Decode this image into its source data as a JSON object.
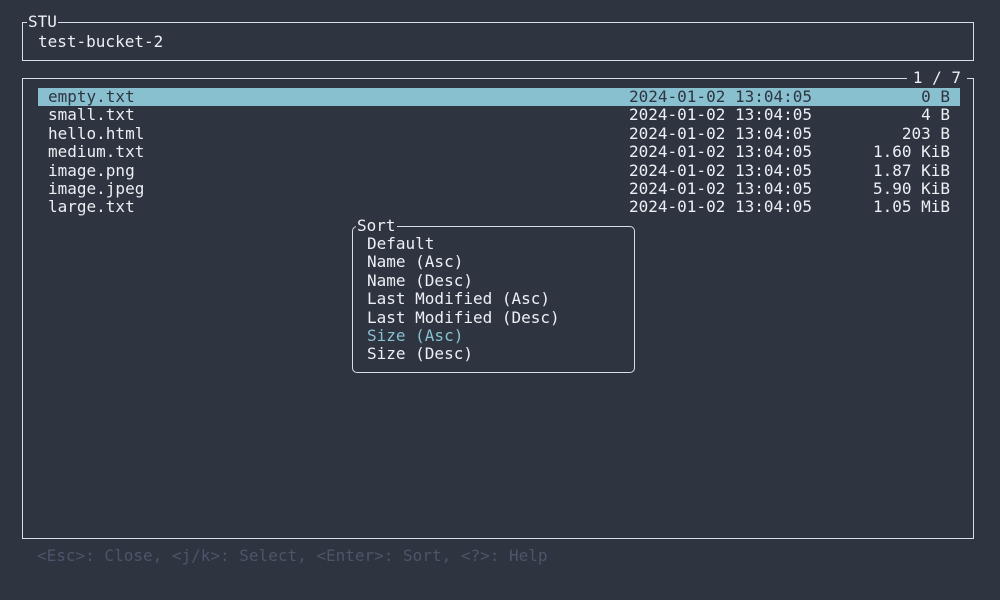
{
  "app": {
    "title": "STU",
    "bucket": "test-bucket-2"
  },
  "list": {
    "page_indicator": "1 / 7",
    "selected_index": 0,
    "items": [
      {
        "name": "empty.txt",
        "modified": "2024-01-02 13:04:05",
        "size": "0 B"
      },
      {
        "name": "small.txt",
        "modified": "2024-01-02 13:04:05",
        "size": "4 B"
      },
      {
        "name": "hello.html",
        "modified": "2024-01-02 13:04:05",
        "size": "203 B"
      },
      {
        "name": "medium.txt",
        "modified": "2024-01-02 13:04:05",
        "size": "1.60 KiB"
      },
      {
        "name": "image.png",
        "modified": "2024-01-02 13:04:05",
        "size": "1.87 KiB"
      },
      {
        "name": "image.jpeg",
        "modified": "2024-01-02 13:04:05",
        "size": "5.90 KiB"
      },
      {
        "name": "large.txt",
        "modified": "2024-01-02 13:04:05",
        "size": "1.05 MiB"
      }
    ]
  },
  "sort_dialog": {
    "title": "Sort",
    "selected_index": 5,
    "options": [
      "Default",
      "Name (Asc)",
      "Name (Desc)",
      "Last Modified (Asc)",
      "Last Modified (Desc)",
      "Size (Asc)",
      "Size (Desc)"
    ]
  },
  "help": {
    "text": "<Esc>: Close, <j/k>: Select, <Enter>: Sort, <?>: Help"
  },
  "colors": {
    "background": "#2e3440",
    "foreground": "#eceff4",
    "accent": "#88c0d0",
    "muted": "#4c566a"
  }
}
